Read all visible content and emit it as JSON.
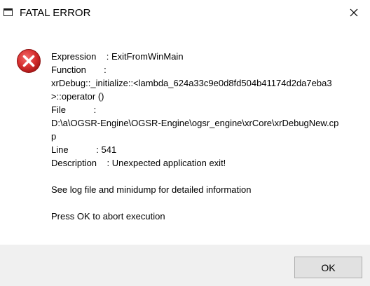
{
  "window": {
    "title": "FATAL ERROR",
    "app_icon": "window-icon",
    "close_icon": "close-icon"
  },
  "dialog": {
    "icon": "error-icon",
    "lines": [
      "Expression    : ExitFromWinMain",
      "Function       :",
      "xrDebug::_initialize::<lambda_624a33c9e0d8fd504b41174d2da7eba3",
      ">::operator ()",
      "File           :",
      "D:\\a\\OGSR-Engine\\OGSR-Engine\\ogsr_engine\\xrCore\\xrDebugNew.cp",
      "p",
      "Line           : 541",
      "Description    : Unexpected application exit!"
    ],
    "log_note": "See log file and minidump for detailed information",
    "abort_note": "Press OK to abort execution"
  },
  "buttons": {
    "ok_label": "OK"
  },
  "colors": {
    "error_red": "#d42c2c",
    "footer_bg": "#f0f0f0",
    "button_bg": "#e1e1e1",
    "button_border": "#adadad"
  }
}
